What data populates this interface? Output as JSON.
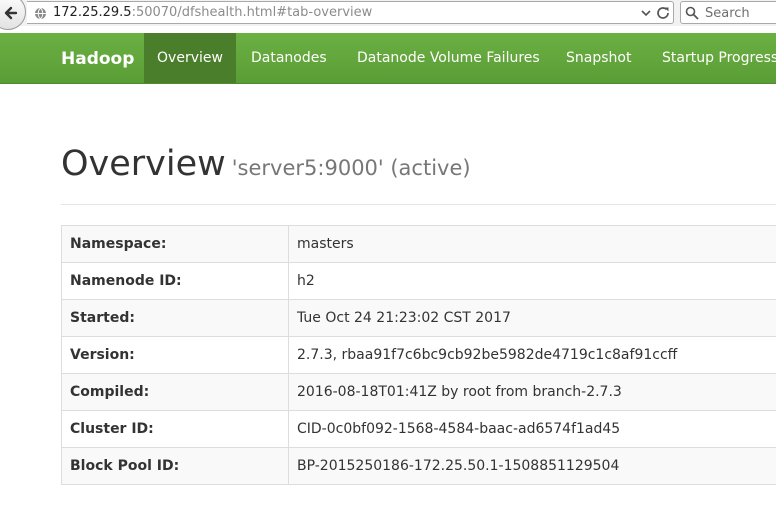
{
  "browser": {
    "url_host": "172.25.29.5",
    "url_rest": ":50070/dfshealth.html#tab-overview",
    "search_placeholder": "Search"
  },
  "navbar": {
    "brand": "Hadoop",
    "items": [
      {
        "label": "Overview",
        "active": true
      },
      {
        "label": "Datanodes"
      },
      {
        "label": "Datanode Volume Failures"
      },
      {
        "label": "Snapshot"
      },
      {
        "label": "Startup Progress"
      }
    ]
  },
  "header": {
    "title": "Overview",
    "subtitle": "'server5:9000' (active)"
  },
  "overview_table": [
    {
      "key": "Namespace:",
      "value": "masters"
    },
    {
      "key": "Namenode ID:",
      "value": "h2"
    },
    {
      "key": "Started:",
      "value": "Tue Oct 24 21:23:02 CST 2017"
    },
    {
      "key": "Version:",
      "value": "2.7.3, rbaa91f7c6bc9cb92be5982de4719c1c8af91ccff"
    },
    {
      "key": "Compiled:",
      "value": "2016-08-18T01:41Z by root from branch-2.7.3"
    },
    {
      "key": "Cluster ID:",
      "value": "CID-0c0bf092-1568-4584-baac-ad6574f1ad45"
    },
    {
      "key": "Block Pool ID:",
      "value": "BP-2015250186-172.25.50.1-1508851129504"
    }
  ],
  "colors": {
    "navbar": "#5fa33a",
    "navbar_active": "#4a7e2a"
  },
  "icons": [
    "back-arrow-icon",
    "globe-icon",
    "chevron-down-icon",
    "reload-icon",
    "search-icon"
  ]
}
